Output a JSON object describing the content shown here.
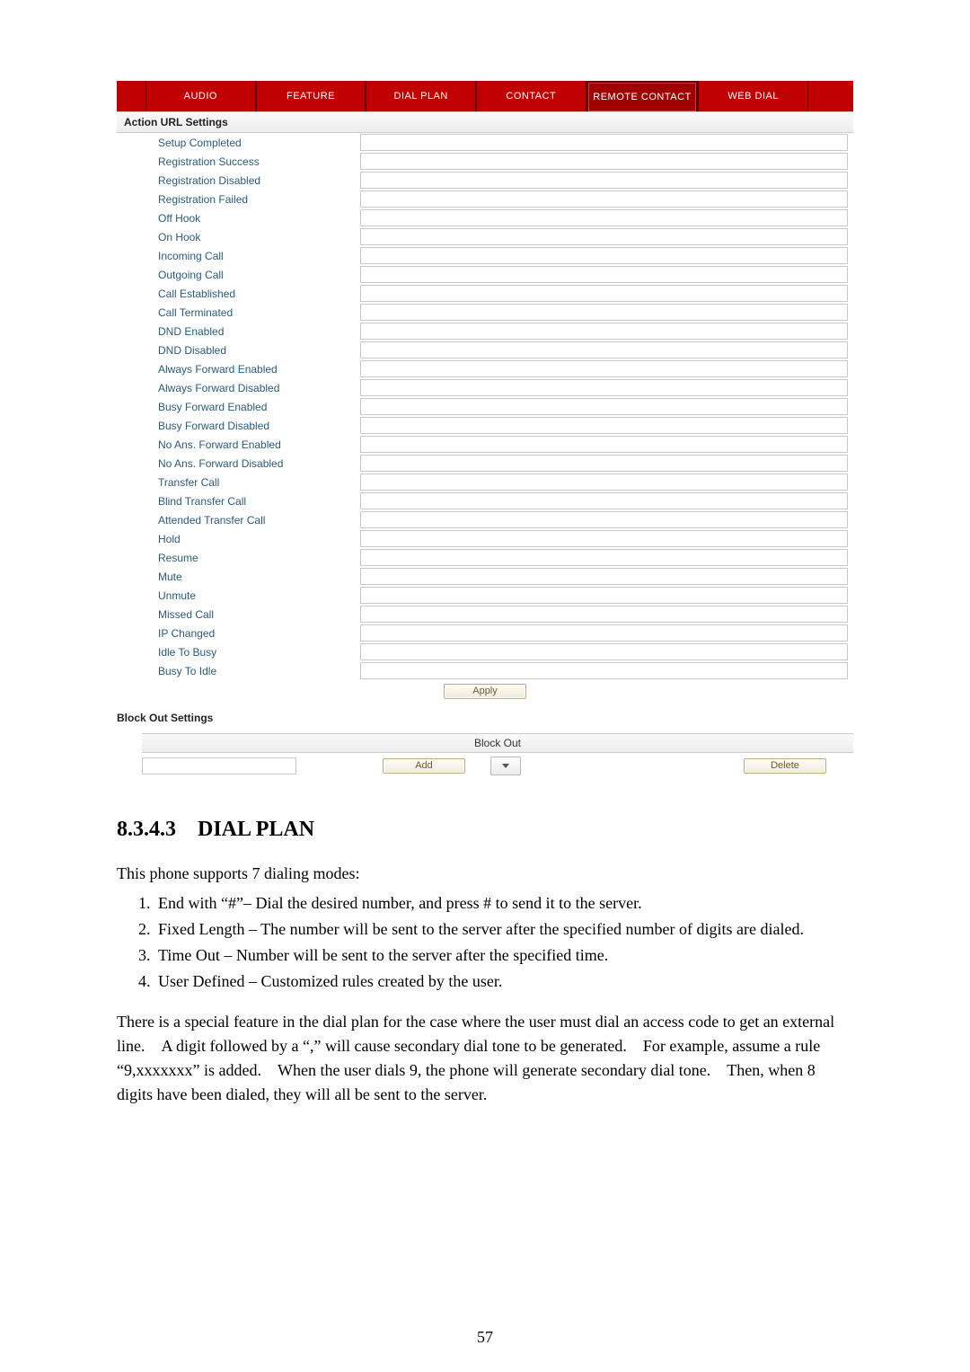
{
  "tabs": {
    "audio": "AUDIO",
    "feature": "FEATURE",
    "dial_plan": "DIAL PLAN",
    "contact": "CONTACT",
    "remote_contact": "REMOTE CONTACT",
    "web_dial": "WEB DIAL"
  },
  "action_url": {
    "heading": "Action URL Settings",
    "rows": [
      "Setup Completed",
      "Registration Success",
      "Registration Disabled",
      "Registration Failed",
      "Off Hook",
      "On Hook",
      "Incoming Call",
      "Outgoing Call",
      "Call Established",
      "Call Terminated",
      "DND Enabled",
      "DND Disabled",
      "Always Forward Enabled",
      "Always Forward Disabled",
      "Busy Forward Enabled",
      "Busy Forward Disabled",
      "No Ans. Forward Enabled",
      "No Ans. Forward Disabled",
      "Transfer Call",
      "Blind Transfer Call",
      "Attended Transfer Call",
      "Hold",
      "Resume",
      "Mute",
      "Unmute",
      "Missed Call",
      "IP Changed",
      "Idle To Busy",
      "Busy To Idle"
    ],
    "apply": "Apply"
  },
  "block_out": {
    "section_heading": "Block Out Settings",
    "column_heading": "Block Out",
    "add": "Add",
    "delete": "Delete"
  },
  "doc": {
    "heading_num": "8.3.4.3",
    "heading_title": "DIAL PLAN",
    "intro": "This phone supports 7 dialing modes:",
    "li1": "End with “#”– Dial the desired number, and press # to send it to the server.",
    "li2": "Fixed Length – The number will be sent to the server after the specified number of digits are dialed.",
    "li3": "Time Out – Number will be sent to the server after the specified time.",
    "li4": "User Defined – Customized rules created by the user.",
    "para": "There is a special feature in the dial plan for the case where the user must dial an access code to get an external line. A digit followed by a “,” will cause secondary dial tone to be generated. For example, assume a rule “9,xxxxxxx” is added. When the user dials 9, the phone will generate secondary dial tone. Then, when 8 digits have been dialed, they will all be sent to the server."
  },
  "page_number": "57"
}
